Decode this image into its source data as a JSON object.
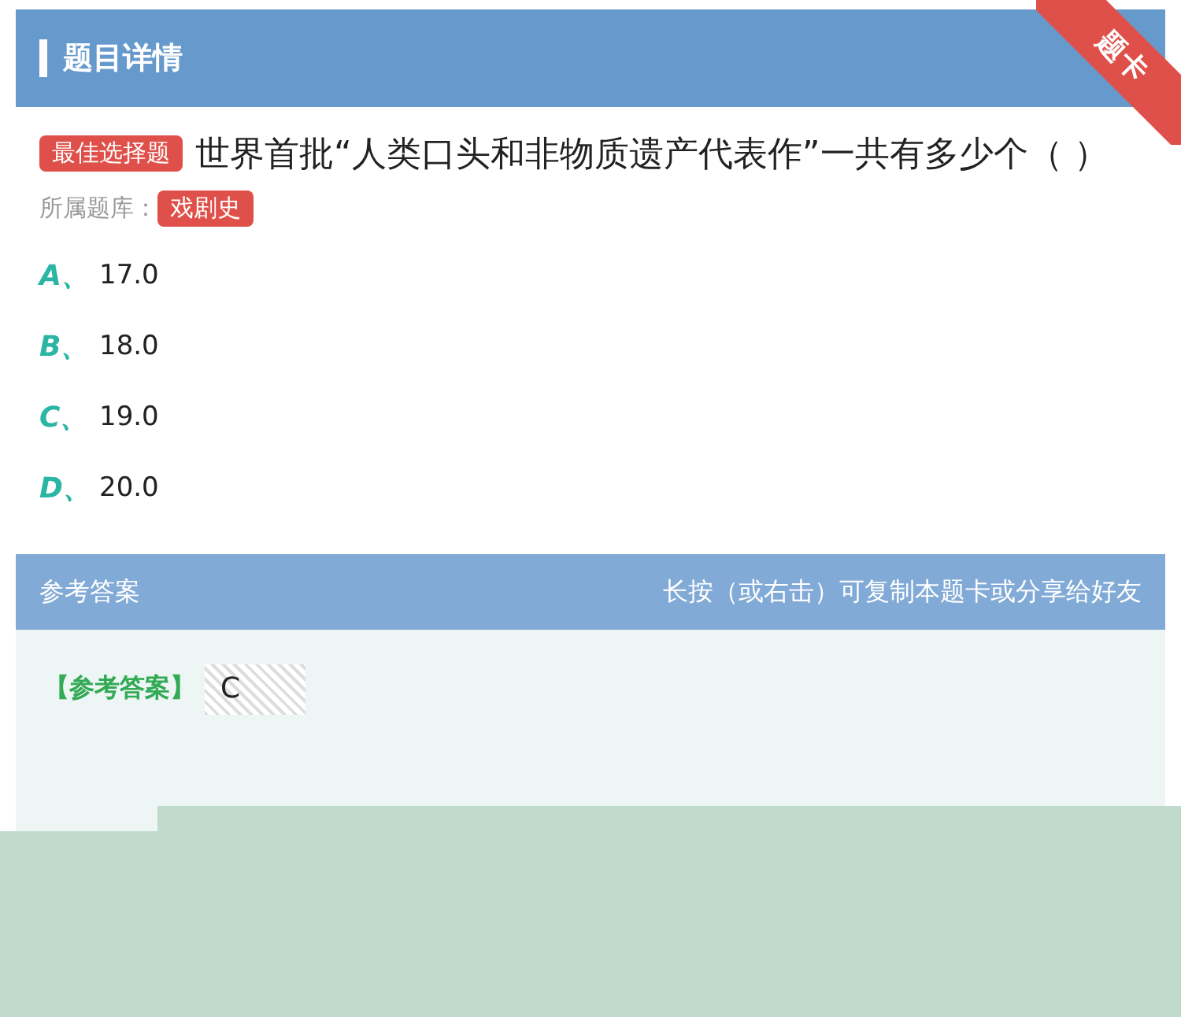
{
  "header": {
    "title": "题目详情",
    "corner_tag": "题卡"
  },
  "question": {
    "type_badge": "最佳选择题",
    "text": "世界首批“人类口头和非物质遗产代表作”一共有多少个（ ）",
    "bank_label": "所属题库：",
    "bank": "戏剧史"
  },
  "options": [
    {
      "letter": "A、",
      "text": "17.0"
    },
    {
      "letter": "B、",
      "text": "18.0"
    },
    {
      "letter": "C、",
      "text": "19.0"
    },
    {
      "letter": "D、",
      "text": "20.0"
    }
  ],
  "answer_bar": {
    "title": "参考答案",
    "hint": "长按（或右击）可复制本题卡或分享给好友"
  },
  "answer": {
    "label": "【参考答案】",
    "value": "C"
  }
}
